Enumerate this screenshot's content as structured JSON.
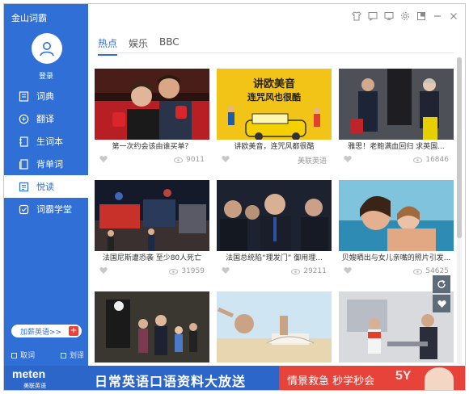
{
  "app": {
    "title": "金山词霸"
  },
  "sidebar": {
    "login_label": "登录",
    "items": [
      {
        "label": "词典",
        "icon": "book-icon"
      },
      {
        "label": "翻译",
        "icon": "translate-icon"
      },
      {
        "label": "生词本",
        "icon": "notebook-icon"
      },
      {
        "label": "背单词",
        "icon": "flashcard-icon"
      },
      {
        "label": "悦读",
        "icon": "reading-icon",
        "active": true
      },
      {
        "label": "词霸学堂",
        "icon": "classroom-icon"
      }
    ],
    "add_english_label": "加薪英语>>",
    "add_english_plus": "+",
    "option_1": "取词",
    "option_2": "划译"
  },
  "tabs": [
    {
      "label": "热点",
      "active": true
    },
    {
      "label": "娱乐"
    },
    {
      "label": "BBC"
    }
  ],
  "cards": [
    {
      "title": "第一次约会该由谁买单？",
      "views": "9011",
      "source": ""
    },
    {
      "title": "讲欧美音，连咒风都很酷",
      "views": "",
      "source": "美联英语"
    },
    {
      "title": "雅思！老鲍满血回归 求英国...",
      "views": "16846",
      "source": ""
    },
    {
      "title": "法国尼斯遭恐袭 至少80人死亡",
      "views": "31959",
      "source": ""
    },
    {
      "title": "法国总统陷“理发门” 御用理...",
      "views": "29211",
      "source": ""
    },
    {
      "title": "贝嫂晒出与女儿亲嘴的照片引发...",
      "views": "54625",
      "source": ""
    },
    {
      "title": "",
      "views": "",
      "source": ""
    },
    {
      "title": "",
      "views": "",
      "source": ""
    },
    {
      "title": "",
      "views": "",
      "source": ""
    }
  ],
  "card2_image_text": {
    "line1": "讲欧美音",
    "line2": "连咒风也很酷"
  },
  "banner": {
    "logo": "meten",
    "logo_sub": "美联英语",
    "headline": "日常英语口语资料大放送",
    "promo": "情景救急 秒学秒会",
    "watermark": "5Y"
  },
  "colors": {
    "accent": "#2f6fd6",
    "promo_red": "#e8433a"
  }
}
